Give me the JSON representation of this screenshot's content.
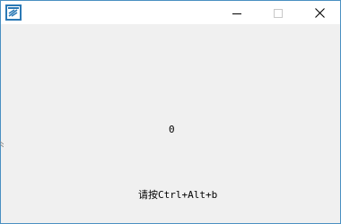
{
  "window": {
    "title": "",
    "icon": "app-window-icon",
    "controls": {
      "minimize_icon": "minimize-icon",
      "maximize_icon": "maximize-icon",
      "close_icon": "close-icon"
    }
  },
  "content": {
    "counter_value": "0",
    "hint_text": "请按Ctrl+Alt+b"
  },
  "colors": {
    "window_border": "#4a90c2",
    "titlebar_bg": "#ffffff",
    "client_bg": "#f0f0f0",
    "icon_blue": "#2b79b5",
    "disabled_gray": "#c8c8c8"
  }
}
